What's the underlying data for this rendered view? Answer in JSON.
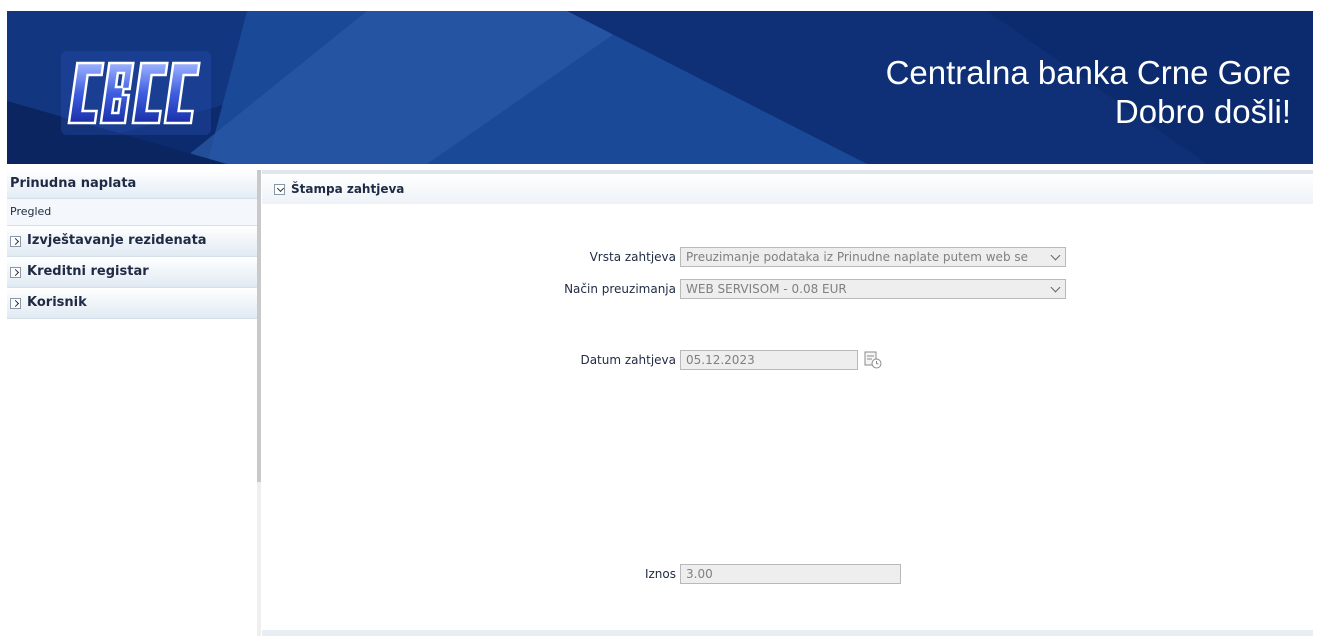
{
  "header": {
    "logo_text": "CBCG",
    "title_line1": "Centralna banka Crne Gore",
    "title_line2": "Dobro došli!"
  },
  "sidebar": {
    "section_title": "Prinudna naplata",
    "section_item": "Pregled",
    "groups": [
      {
        "label": "Izvještavanje rezidenata",
        "icon": "chevron-right-icon"
      },
      {
        "label": "Kreditni registar",
        "icon": "chevron-right-icon"
      },
      {
        "label": "Korisnik",
        "icon": "chevron-right-icon"
      }
    ]
  },
  "main": {
    "panel_title": "Štampa zahtjeva",
    "form": {
      "vrsta_label": "Vrsta zahtjeva",
      "vrsta_value": "Preuzimanje podataka iz Prinudne naplate putem web se",
      "nacin_label": "Način preuzimanja",
      "nacin_value": "WEB SERVISOM - 0.08 EUR",
      "datum_label": "Datum zahtjeva",
      "datum_value": "05.12.2023",
      "iznos_label": "Iznos",
      "iznos_value": "3.00"
    }
  },
  "colors": {
    "banner": "#0c2b6e",
    "text": "#1f2a44",
    "disabled_field": "#eeeeee"
  }
}
